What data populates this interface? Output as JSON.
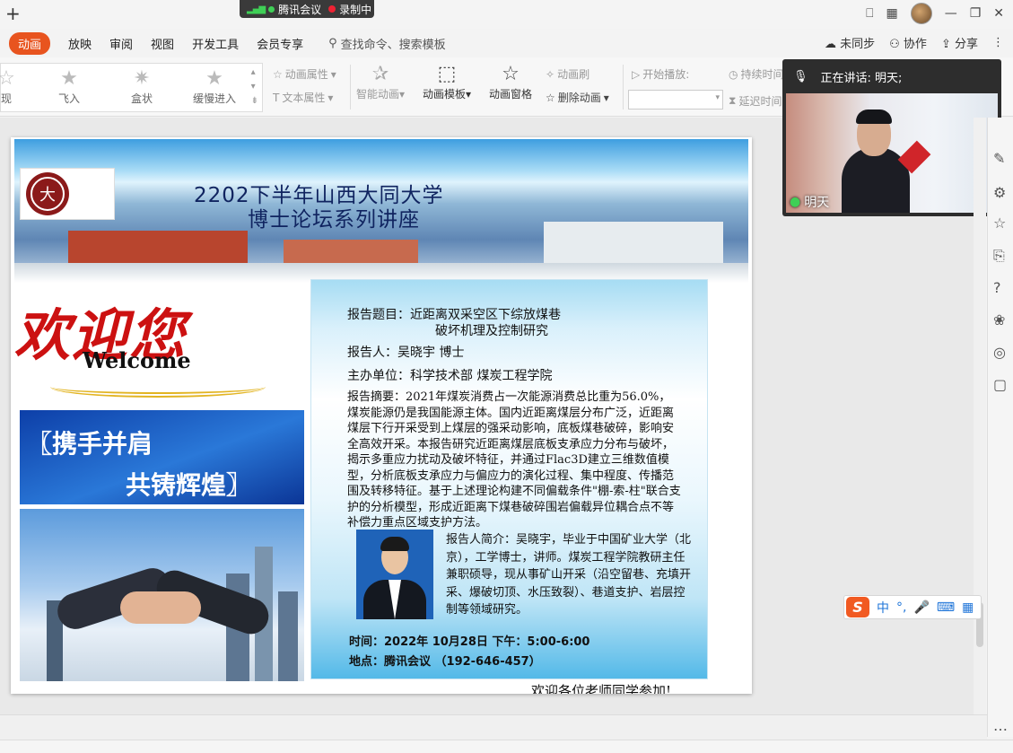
{
  "meeting": {
    "app_name": "腾讯会议",
    "recording_label": "录制中"
  },
  "tabs": {
    "items": [
      "动画",
      "放映",
      "审阅",
      "视图",
      "开发工具",
      "会员专享"
    ],
    "search_placeholder": "查找命令、搜索模板",
    "right": [
      "未同步",
      "协作",
      "分享"
    ]
  },
  "ribbon": {
    "gallery": [
      "现",
      "飞入",
      "盒状",
      "缓慢进入"
    ],
    "animation_props": "动画属性",
    "text_props": "文本属性",
    "smart_animation": "智能动画",
    "animation_template": "动画模板",
    "animation_pane": "动画窗格",
    "animation_brush": "动画刷",
    "delete_animation": "删除动画",
    "start_play": "开始播放:",
    "duration": "持续时间",
    "delay": "延迟时间"
  },
  "video": {
    "speaking_label": "正在讲话: 明天;",
    "participant_name": "明天"
  },
  "slide": {
    "title_line1": "2202下半年山西大同大学",
    "title_line2": "博士论坛系列讲座",
    "welcome_cn": "欢迎您",
    "welcome_en": "Welcome",
    "slogan_line1": "〖携手并肩",
    "slogan_line2": "共铸辉煌〗",
    "topic_label": "报告题目：近距离双采空区下综放煤巷",
    "topic_line2": "破坏机理及控制研究",
    "speaker": "报告人：吴晓宇   博士",
    "host": "主办单位：科学技术部     煤炭工程学院",
    "abstract": "报告摘要：2021年煤炭消费占一次能源消费总比重为56.0%，煤炭能源仍是我国能源主体。国内近距离煤层分布广泛，近距离煤层下行开采受到上煤层的强采动影响，底板煤巷破碎，影响安全高效开采。本报告研究近距离煤层底板支承应力分布与破坏，揭示多重应力扰动及破坏特征，并通过Flac3D建立三维数值模型，分析底板支承应力与偏应力的演化过程、集中程度、传播范围及转移特征。基于上述理论构建不同偏载条件\"棚-索-柱\"联合支护的分析模型，形成近距离下煤巷破碎围岩偏载异位耦合点不等补偿力重点区域支护方法。",
    "bio": "报告人简介：吴晓宇，毕业于中国矿业大学（北京），工学博士，讲师。煤炭工程学院教研主任兼职硕导，现从事矿山开采（沿空留巷、充填开采、爆破切顶、水压致裂）、巷道支护、岩层控制等领域研究。",
    "time": "时间：2022年 10月28日   下午：5:00-6:00",
    "place": "地点：腾讯会议  （192-646-457）",
    "caption": "欢迎各位老师同学参加!"
  },
  "ime": {
    "mode": "中",
    "punct": "°,"
  },
  "colors": {
    "accent": "#e8541f",
    "title_text": "#102460"
  }
}
